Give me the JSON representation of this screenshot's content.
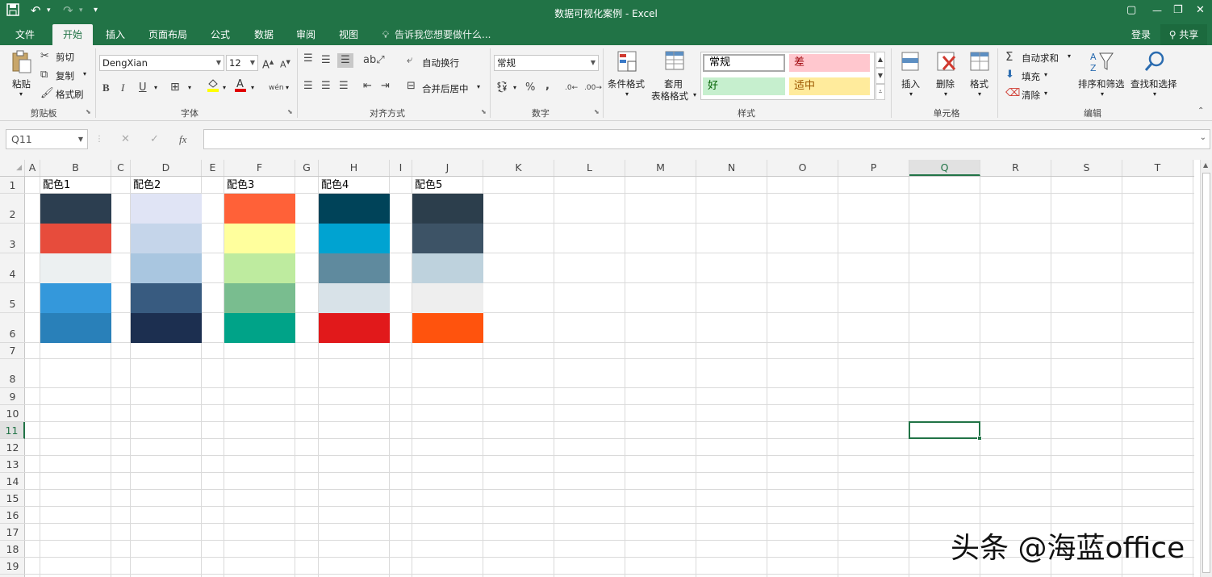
{
  "app": {
    "title": "数据可视化案例 - Excel",
    "qat": {
      "save_icon": "floppy-icon",
      "undo_icon": "↶",
      "redo_icon": "↷",
      "customize_icon": "▾"
    },
    "window": {
      "ribbon_display": "▢",
      "minimize": "—",
      "restore": "❐",
      "close": "✕"
    }
  },
  "tabs": [
    {
      "label": "文件"
    },
    {
      "label": "开始",
      "active": true
    },
    {
      "label": "插入"
    },
    {
      "label": "页面布局"
    },
    {
      "label": "公式"
    },
    {
      "label": "数据"
    },
    {
      "label": "审阅"
    },
    {
      "label": "视图"
    }
  ],
  "tellme": "告诉我您想要做什么...",
  "account": {
    "login": "登录",
    "share": "共享"
  },
  "ribbon": {
    "clipboard": {
      "label": "剪贴板",
      "paste": "粘贴",
      "cut": "剪切",
      "copy": "复制",
      "format_painter": "格式刷"
    },
    "font": {
      "label": "字体",
      "name": "DengXian",
      "size": "12",
      "bold": "B",
      "italic": "I",
      "underline": "U",
      "phonetic": "wén"
    },
    "alignment": {
      "label": "对齐方式",
      "wrap": "自动换行",
      "merge": "合并后居中"
    },
    "number": {
      "label": "数字",
      "format": "常规",
      "percent": "%",
      "comma": ","
    },
    "styles": {
      "label": "样式",
      "conditional": "条件格式",
      "table_format_1": "套用",
      "table_format_2": "表格格式",
      "normal": "常规",
      "bad": "差",
      "good": "好",
      "neutral": "适中"
    },
    "cells": {
      "label": "单元格",
      "insert": "插入",
      "delete": "删除",
      "format": "格式"
    },
    "editing": {
      "label": "编辑",
      "autosum": "自动求和",
      "fill": "填充",
      "clear": "清除",
      "sort": "排序和筛选",
      "find": "查找和选择"
    }
  },
  "formula_bar": {
    "name_box": "Q11",
    "cancel": "✕",
    "enter": "✓",
    "fx": "fx",
    "content": ""
  },
  "sheet": {
    "columns": [
      "A",
      "B",
      "C",
      "D",
      "E",
      "F",
      "G",
      "H",
      "I",
      "J",
      "K",
      "L",
      "M",
      "N",
      "O",
      "P",
      "Q",
      "R",
      "S",
      "T"
    ],
    "rows": [
      "1",
      "2",
      "3",
      "4",
      "5",
      "6",
      "7",
      "8",
      "9",
      "10",
      "11",
      "12",
      "13",
      "14",
      "15",
      "16",
      "17",
      "18",
      "19"
    ],
    "selected_cell": "Q11",
    "palettes": [
      {
        "label": "配色1",
        "column": "B",
        "colors": [
          "#2c3e50",
          "#e74c3c",
          "#ecf0f1",
          "#3498db",
          "#2980b9"
        ]
      },
      {
        "label": "配色2",
        "column": "D",
        "colors": [
          "#e0e4f5",
          "#c5d5ea",
          "#a9c6e0",
          "#385b80",
          "#1c2f50"
        ]
      },
      {
        "label": "配色3",
        "column": "F",
        "colors": [
          "#ff6138",
          "#ffff9d",
          "#beeb9f",
          "#79bd8f",
          "#00a388"
        ]
      },
      {
        "label": "配色4",
        "column": "H",
        "colors": [
          "#004359",
          "#00a3d1",
          "#5f8a9e",
          "#d8e2e8",
          "#e1191b"
        ]
      },
      {
        "label": "配色5",
        "column": "J",
        "colors": [
          "#2c3e4c",
          "#3d5366",
          "#bed2dd",
          "#eeeeee",
          "#ff530d"
        ]
      }
    ]
  },
  "watermark": "头条 @海蓝office"
}
